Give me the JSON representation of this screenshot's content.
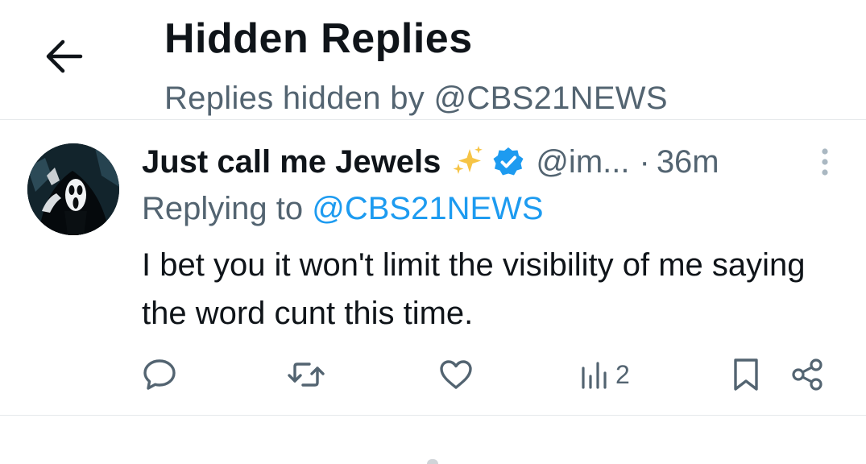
{
  "header": {
    "title": "Hidden Replies",
    "subtitle": "Replies hidden by @CBS21NEWS"
  },
  "tweet": {
    "display_name": "Just call me Jewels",
    "handle": "@im...",
    "separator": "·",
    "time": "36m",
    "replying_prefix": "Replying to",
    "replying_handle": "@CBS21NEWS",
    "text": "I bet you it won't limit the visibility of me saying the word cunt this time.",
    "views_count": "2"
  },
  "icons": {
    "back": "arrow-left-icon",
    "sparkles": "sparkles-icon",
    "verified": "verified-badge-icon",
    "more": "more-vertical-icon",
    "reply": "comment-icon",
    "retweet": "retweet-icon",
    "like": "heart-icon",
    "views": "views-icon",
    "bookmark": "bookmark-icon",
    "share": "share-icon"
  },
  "colors": {
    "text": "#0f1419",
    "secondary": "#536471",
    "accent": "#1d9bf0",
    "divider": "#e6e9eb"
  }
}
